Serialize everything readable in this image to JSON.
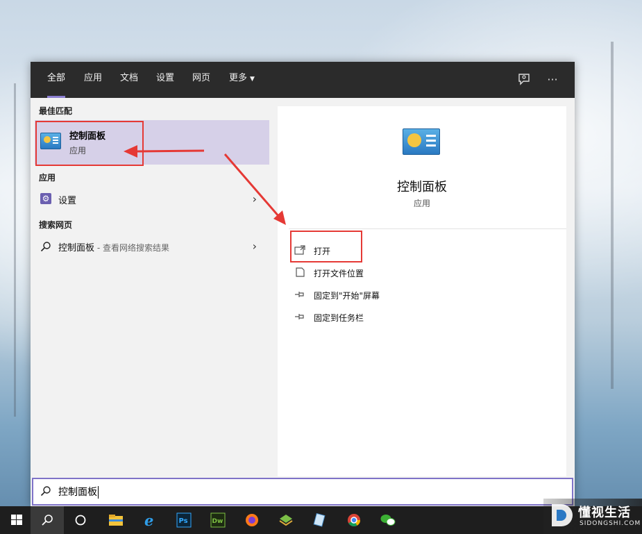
{
  "tabs": [
    {
      "label": "全部"
    },
    {
      "label": "应用"
    },
    {
      "label": "文档"
    },
    {
      "label": "设置"
    },
    {
      "label": "网页"
    },
    {
      "label": "更多"
    }
  ],
  "left": {
    "best_match_title": "最佳匹配",
    "best_match": {
      "name": "控制面板",
      "type": "应用"
    },
    "apps_title": "应用",
    "apps": [
      {
        "label": "设置"
      }
    ],
    "web_title": "搜索网页",
    "web": [
      {
        "label": "控制面板",
        "hint": " - 查看网络搜索结果"
      }
    ]
  },
  "right": {
    "name": "控制面板",
    "type": "应用",
    "actions": [
      {
        "label": "打开",
        "icon": "open-icon"
      },
      {
        "label": "打开文件位置",
        "icon": "file-location-icon"
      },
      {
        "label": "固定到\"开始\"屏幕",
        "icon": "pin-icon"
      },
      {
        "label": "固定到任务栏",
        "icon": "pin-icon"
      }
    ]
  },
  "search": {
    "query": "控制面板"
  },
  "taskbar": {
    "items": [
      "windows-start-icon",
      "search-icon",
      "cortana-icon",
      "file-explorer-icon",
      "internet-explorer-icon",
      "photoshop-icon",
      "dreamweaver-icon",
      "firefox-icon",
      "app-icon",
      "app-icon",
      "chrome-icon",
      "wechat-icon"
    ]
  },
  "watermark": {
    "cn": "懂视生活",
    "en": "SIDONGSHI.COM"
  },
  "colors": {
    "accent": "#8b7fd1",
    "selection": "#d6d0e8",
    "annotation": "#e53935"
  }
}
